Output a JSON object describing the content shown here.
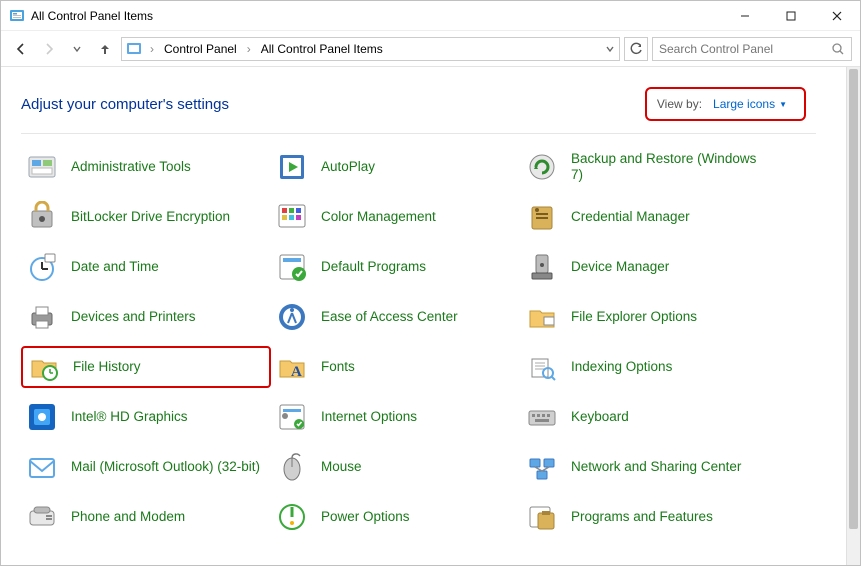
{
  "window": {
    "title": "All Control Panel Items"
  },
  "breadcrumbs": {
    "root": "Control Panel",
    "current": "All Control Panel Items"
  },
  "search": {
    "placeholder": "Search Control Panel"
  },
  "heading": "Adjust your computer's settings",
  "viewby": {
    "label": "View by:",
    "value": "Large icons"
  },
  "items": [
    {
      "label": "Administrative Tools",
      "icon": "admin-tools"
    },
    {
      "label": "AutoPlay",
      "icon": "autoplay"
    },
    {
      "label": "Backup and Restore (Windows 7)",
      "icon": "backup"
    },
    {
      "label": "BitLocker Drive Encryption",
      "icon": "bitlocker"
    },
    {
      "label": "Color Management",
      "icon": "color"
    },
    {
      "label": "Credential Manager",
      "icon": "credential"
    },
    {
      "label": "Date and Time",
      "icon": "datetime"
    },
    {
      "label": "Default Programs",
      "icon": "defaults"
    },
    {
      "label": "Device Manager",
      "icon": "devicemgr"
    },
    {
      "label": "Devices and Printers",
      "icon": "printers"
    },
    {
      "label": "Ease of Access Center",
      "icon": "ease"
    },
    {
      "label": "File Explorer Options",
      "icon": "explorer-opts"
    },
    {
      "label": "File History",
      "icon": "filehistory",
      "highlight": true
    },
    {
      "label": "Fonts",
      "icon": "fonts"
    },
    {
      "label": "Indexing Options",
      "icon": "indexing"
    },
    {
      "label": "Intel® HD Graphics",
      "icon": "intel"
    },
    {
      "label": "Internet Options",
      "icon": "internet"
    },
    {
      "label": "Keyboard",
      "icon": "keyboard"
    },
    {
      "label": "Mail (Microsoft Outlook) (32-bit)",
      "icon": "mail"
    },
    {
      "label": "Mouse",
      "icon": "mouse"
    },
    {
      "label": "Network and Sharing Center",
      "icon": "network"
    },
    {
      "label": "Phone and Modem",
      "icon": "phone"
    },
    {
      "label": "Power Options",
      "icon": "power"
    },
    {
      "label": "Programs and Features",
      "icon": "programs"
    }
  ]
}
